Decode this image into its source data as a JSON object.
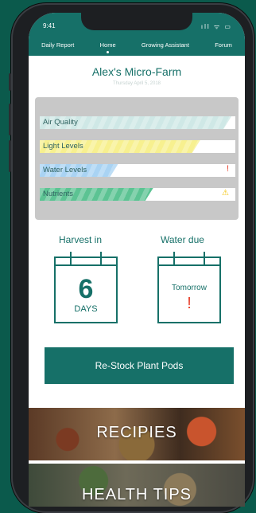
{
  "status_bar": {
    "time": "9:41",
    "icons": "ıll ᯤ ▭"
  },
  "nav": {
    "items": [
      "Daily Report",
      "Home",
      "Growing Assistant",
      "Forum"
    ],
    "active": "Home"
  },
  "farm": {
    "title": "Alex's Micro-Farm",
    "date": "Thursday April 5, 2018"
  },
  "metrics": [
    {
      "label": "Air Quality",
      "level": 0.98,
      "color": "#cfe8e6",
      "alert": ""
    },
    {
      "label": "Light Levels",
      "level": 0.82,
      "color": "#f7f08f",
      "alert": ""
    },
    {
      "label": "Water Levels",
      "level": 0.4,
      "color": "#a9d3f3",
      "alert": "!"
    },
    {
      "label": "Nutrients",
      "level": 0.58,
      "color": "#5cc393",
      "alert": "⚠"
    }
  ],
  "harvest": {
    "title": "Harvest in",
    "value": "6",
    "unit": "DAYS"
  },
  "water": {
    "title": "Water due",
    "value": "Tomorrow",
    "alert": "!"
  },
  "restock_label": "Re-Stock Plant Pods",
  "banners": {
    "recipes": "RECIPIES",
    "health": "HEALTH TIPS"
  },
  "colors": {
    "brand": "#167068",
    "alert_red": "#e8422e",
    "warn_yellow": "#f2c200"
  }
}
